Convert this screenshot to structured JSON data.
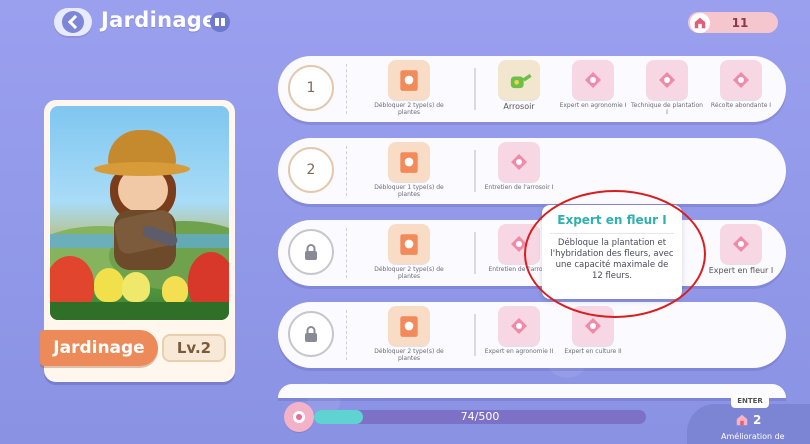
{
  "header": {
    "title": "Jardinage"
  },
  "currency": {
    "value": "11"
  },
  "card": {
    "name": "Jardinage",
    "level": "Lv.2"
  },
  "tiers": [
    {
      "badge": "1",
      "items": [
        {
          "caption": "Débloquer 2 type(s) de plantes",
          "icon": "book-icon"
        },
        {
          "caption": "Arrosoir",
          "icon": "watering-can-icon"
        },
        {
          "caption": "Expert en agronomie I",
          "icon": "watering-can-icon"
        },
        {
          "caption": "Technique de plantation I",
          "icon": "watering-can-icon"
        },
        {
          "caption": "Récolte abondante I",
          "icon": "watering-can-icon"
        }
      ]
    },
    {
      "badge": "2",
      "items": [
        {
          "caption": "Débloquer 1 type(s) de plantes",
          "icon": "book-icon"
        },
        {
          "caption": "Entretien de l'arrosoir I",
          "icon": "watering-can-icon"
        }
      ]
    },
    {
      "badge": "",
      "items": [
        {
          "caption": "Débloquer 2 type(s) de plantes",
          "icon": "book-icon"
        },
        {
          "caption": "Entretien de l'arroso",
          "icon": "watering-can-icon"
        },
        {
          "caption": "Expert en fleur I",
          "icon": "watering-can-icon"
        }
      ]
    },
    {
      "badge": "",
      "items": [
        {
          "caption": "Débloquer 2 type(s) de plantes",
          "icon": "book-icon"
        },
        {
          "caption": "Expert en agronomie II",
          "icon": "watering-can-icon"
        },
        {
          "caption": "Expert en culture II",
          "icon": "watering-can-icon"
        }
      ]
    }
  ],
  "tooltip": {
    "title": "Expert en fleur I",
    "body": "Débloque la plantation et l'hybridation des fleurs, avec une capacité maximale de 12 fleurs."
  },
  "progress": {
    "text": "74/500",
    "fraction": 0.148
  },
  "upgrade": {
    "enter": "ENTER",
    "cost": "2",
    "label": "Amélioration de"
  },
  "colors": {
    "accent_teal": "#2fb0b0",
    "highlight_red": "#d81e1e",
    "ribbon": "#ec8a5a"
  }
}
